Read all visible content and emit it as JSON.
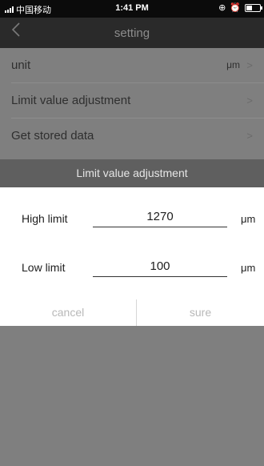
{
  "status_bar": {
    "carrier": "中国移动",
    "time": "1:41 PM"
  },
  "nav": {
    "title": "setting",
    "back_icon": "chevron-left-icon"
  },
  "settings": [
    {
      "label": "unit",
      "value": "μm"
    },
    {
      "label": "Limit value adjustment",
      "value": ""
    },
    {
      "label": "Get stored data",
      "value": ""
    }
  ],
  "dialog": {
    "title": "Limit value adjustment",
    "high_limit": {
      "label": "High limit",
      "value": "1270",
      "unit": "μm"
    },
    "low_limit": {
      "label": "Low limit",
      "value": "100",
      "unit": "μm"
    },
    "cancel_label": "cancel",
    "sure_label": "sure"
  },
  "colors": {
    "overlay": "#7f7f7f",
    "nav_bar": "#2a2a2a",
    "dialog_header": "#5f5f5f",
    "dialog_bg": "#ffffff",
    "button_text": "#b8b8b8"
  }
}
